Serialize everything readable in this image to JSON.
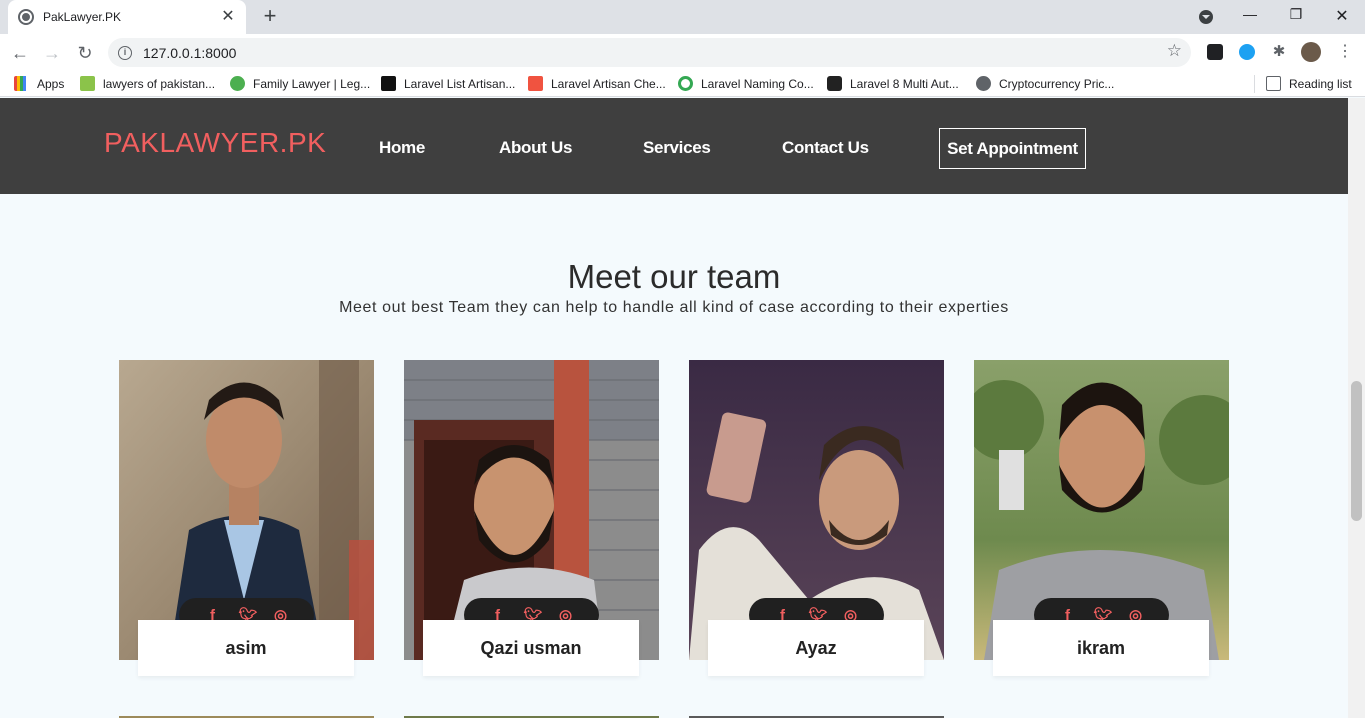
{
  "browser": {
    "tab_title": "PakLawyer.PK",
    "url": "127.0.0.1:8000",
    "bookmarks": [
      {
        "label": "Apps",
        "color": "#e8453c"
      },
      {
        "label": "lawyers of pakistan...",
        "color": "#8bc34a"
      },
      {
        "label": "Family Lawyer | Leg...",
        "color": "#4caf50"
      },
      {
        "label": "Laravel List Artisan...",
        "color": "#111111"
      },
      {
        "label": "Laravel Artisan Che...",
        "color": "#f05340"
      },
      {
        "label": "Laravel Naming Co...",
        "color": "#34a853"
      },
      {
        "label": "Laravel 8 Multi Aut...",
        "color": "#222222"
      },
      {
        "label": "Cryptocurrency Pric...",
        "color": "#5f6368"
      }
    ],
    "reading_list": "Reading list"
  },
  "site": {
    "logo": "PAKLAWYER.PK",
    "nav": {
      "home": "Home",
      "about": "About Us",
      "services": "Services",
      "contact": "Contact Us",
      "appointment": "Set Appointment"
    },
    "team": {
      "title": "Meet our team",
      "subtitle": "Meet out best Team they can help to handle all kind of case according to their experties",
      "members": [
        {
          "name": "asim"
        },
        {
          "name": "Qazi usman"
        },
        {
          "name": "Ayaz"
        },
        {
          "name": "ikram"
        }
      ]
    },
    "social_icons": {
      "facebook": "f",
      "twitter": "t",
      "instagram": "ig"
    },
    "colors": {
      "accent": "#f15f5f",
      "nav_bg": "#3f3f3f",
      "page_bg": "#f4fafd"
    }
  }
}
